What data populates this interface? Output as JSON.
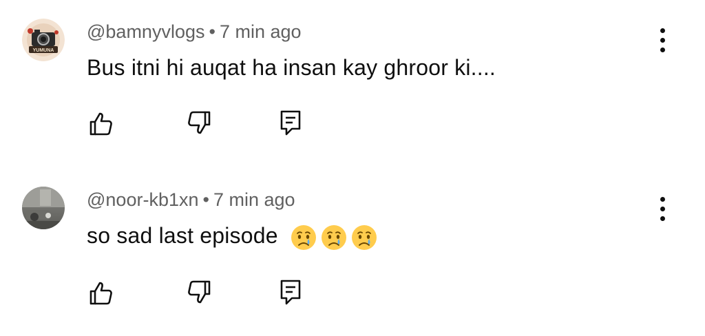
{
  "comments": [
    {
      "handle": "@bamnyvlogs",
      "separator": "•",
      "time": "7 min ago",
      "text": "Bus itni hi auqat ha insan kay ghroor ki....",
      "avatar_label": "YUMUNA",
      "avatar_icon": "camera-logo-avatar",
      "emojis": []
    },
    {
      "handle": "@noor-kb1xn",
      "separator": "•",
      "time": "7 min ago",
      "text": "so sad last episode",
      "avatar_icon": "photo-avatar",
      "emojis": [
        "😢",
        "😢",
        "😢"
      ]
    }
  ],
  "icons": {
    "like": "thumbs-up-icon",
    "dislike": "thumbs-down-icon",
    "reply": "reply-icon",
    "menu": "more-vert-icon"
  },
  "colors": {
    "text": "#0f0f0f",
    "meta": "#606060",
    "background": "#ffffff"
  }
}
